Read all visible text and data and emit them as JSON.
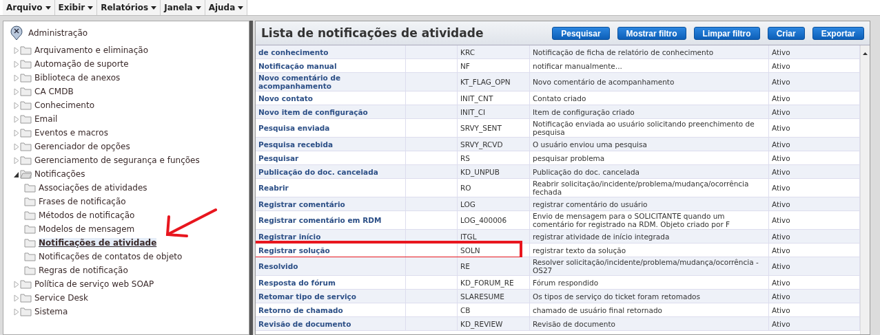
{
  "menu_bar": [
    {
      "label": "Arquivo"
    },
    {
      "label": "Exibir"
    },
    {
      "label": "Relatórios"
    },
    {
      "label": "Janela"
    },
    {
      "label": "Ajuda"
    }
  ],
  "tree": {
    "root": "Administração",
    "items": [
      {
        "label": "Arquivamento e eliminação",
        "expanded": false,
        "selected": false
      },
      {
        "label": "Automação de suporte",
        "expanded": false,
        "selected": false
      },
      {
        "label": "Biblioteca de anexos",
        "expanded": false,
        "selected": false
      },
      {
        "label": "CA CMDB",
        "expanded": false,
        "selected": false
      },
      {
        "label": "Conhecimento",
        "expanded": false,
        "selected": false
      },
      {
        "label": "Email",
        "expanded": false,
        "selected": false
      },
      {
        "label": "Eventos e macros",
        "expanded": false,
        "selected": false
      },
      {
        "label": "Gerenciador de opções",
        "expanded": false,
        "selected": false
      },
      {
        "label": "Gerenciamento de segurança e funções",
        "expanded": false,
        "selected": false
      },
      {
        "label": "Notificações",
        "expanded": true,
        "selected": false,
        "children": [
          {
            "label": "Associações de atividades",
            "selected": false
          },
          {
            "label": "Frases de notificação",
            "selected": false
          },
          {
            "label": "Métodos de notificação",
            "selected": false
          },
          {
            "label": "Modelos de mensagem",
            "selected": false
          },
          {
            "label": "Notificações de atividade",
            "selected": true,
            "pointed": true
          },
          {
            "label": "Notificações de contatos de objeto",
            "selected": false
          },
          {
            "label": "Regras de notificação",
            "selected": false
          }
        ]
      },
      {
        "label": "Política de serviço web SOAP",
        "expanded": false,
        "selected": false
      },
      {
        "label": "Service Desk",
        "expanded": false,
        "selected": false
      },
      {
        "label": "Sistema",
        "expanded": false,
        "selected": false
      }
    ]
  },
  "list": {
    "title": "Lista de notificações de atividade",
    "buttons": [
      "Pesquisar",
      "Mostrar filtro",
      "Limpar filtro",
      "Criar",
      "Exportar"
    ],
    "rows": [
      {
        "name": "de conhecimento",
        "code": "KRC",
        "description": "Notificação de ficha de relatório de conhecimento",
        "status": "Ativo",
        "highlighted": false
      },
      {
        "name": "Notificação manual",
        "code": "NF",
        "description": "notificar manualmente...",
        "status": "Ativo",
        "highlighted": false
      },
      {
        "name": "Novo comentário de acompanhamento",
        "code": "KT_FLAG_OPN",
        "description": "Novo comentário de acompanhamento",
        "status": "Ativo",
        "highlighted": false
      },
      {
        "name": "Novo contato",
        "code": "INIT_CNT",
        "description": "Contato criado",
        "status": "Ativo",
        "highlighted": false
      },
      {
        "name": "Novo item de configuração",
        "code": "INIT_CI",
        "description": "Item de configuração criado",
        "status": "Ativo",
        "highlighted": false
      },
      {
        "name": "Pesquisa enviada",
        "code": "SRVY_SENT",
        "description": "Notificação enviada ao usuário solicitando preenchimento de pesquisa",
        "status": "Ativo",
        "highlighted": false
      },
      {
        "name": "Pesquisa recebida",
        "code": "SRVY_RCVD",
        "description": "O usuário enviou uma pesquisa",
        "status": "Ativo",
        "highlighted": false
      },
      {
        "name": "Pesquisar",
        "code": "RS",
        "description": "pesquisar problema",
        "status": "Ativo",
        "highlighted": false
      },
      {
        "name": "Publicação do doc. cancelada",
        "code": "KD_UNPUB",
        "description": "Publicação do doc. cancelada",
        "status": "Ativo",
        "highlighted": false
      },
      {
        "name": "Reabrir",
        "code": "RO",
        "description": "Reabrir solicitação/incidente/problema/mudança/ocorrência fechada",
        "status": "Ativo",
        "highlighted": false
      },
      {
        "name": "Registrar comentário",
        "code": "LOG",
        "description": "registrar comentário do usuário",
        "status": "Ativo",
        "highlighted": false
      },
      {
        "name": "Registrar comentário em RDM",
        "code": "LOG_400006",
        "description": "Envio de mensagem para o SOLICITANTE quando um comentário for registrado na RDM. Objeto criado por F",
        "status": "Ativo",
        "highlighted": false
      },
      {
        "name": "Registrar início",
        "code": "ITGL",
        "description": "registrar atividade de início integrada",
        "status": "Ativo",
        "highlighted": false
      },
      {
        "name": "Registrar solução",
        "code": "SOLN",
        "description": "registrar texto da solução",
        "status": "Ativo",
        "highlighted": true
      },
      {
        "name": "Resolvido",
        "code": "RE",
        "description": "Resolver solicitação/incidente/problema/mudança/ocorrência - OS27",
        "status": "Ativo",
        "highlighted": false
      },
      {
        "name": "Resposta do fórum",
        "code": "KD_FORUM_RE",
        "description": "Fórum respondido",
        "status": "Ativo",
        "highlighted": false
      },
      {
        "name": "Retomar tipo de serviço",
        "code": "SLARESUME",
        "description": "Os tipos de serviço do ticket foram retomados",
        "status": "Ativo",
        "highlighted": false
      },
      {
        "name": "Retorno de chamado",
        "code": "CB",
        "description": "chamado de usuário final retornado",
        "status": "Ativo",
        "highlighted": false
      },
      {
        "name": "Revisão de documento",
        "code": "KD_REVIEW",
        "description": "Revisão de documento",
        "status": "Ativo",
        "highlighted": false
      }
    ]
  }
}
